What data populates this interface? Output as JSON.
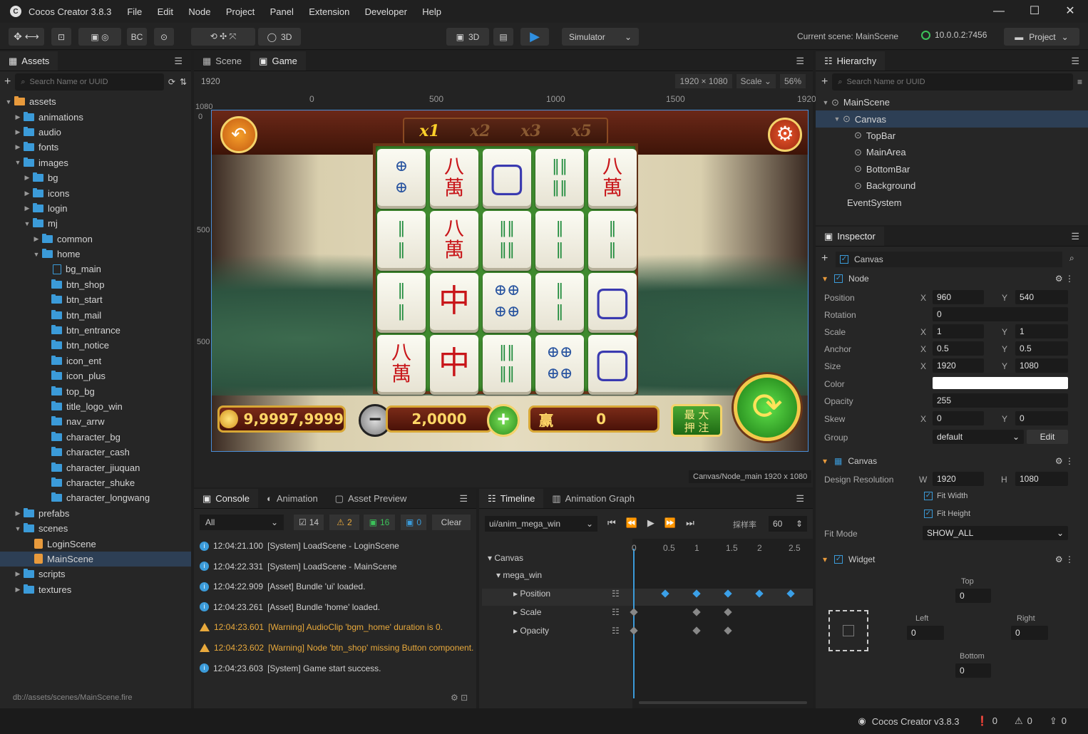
{
  "app": {
    "title": "Cocos Creator 3.8.3",
    "logo": "C"
  },
  "menu": [
    "File",
    "Edit",
    "Node",
    "Project",
    "Panel",
    "Extension",
    "Developer",
    "Help"
  ],
  "window_controls": [
    "—",
    "☐",
    "✕"
  ],
  "toolbar": {
    "scene3d_left": "3D",
    "scene3d_right": "3D",
    "play_label": "▶",
    "simulator": "Simulator",
    "current_scene": "Current scene: MainScene",
    "ip": "10.0.0.2:7456",
    "project": "Project"
  },
  "assets": {
    "tab": "Assets",
    "search_placeholder": "Search Name or UUID",
    "footer_path": "db://assets/scenes/MainScene.fire",
    "tree": [
      {
        "label": "assets",
        "depth": 0,
        "type": "root",
        "arrow": "▼"
      },
      {
        "label": "animations",
        "depth": 1,
        "type": "folder",
        "arrow": "▶"
      },
      {
        "label": "audio",
        "depth": 1,
        "type": "folder",
        "arrow": "▶"
      },
      {
        "label": "fonts",
        "depth": 1,
        "type": "folder",
        "arrow": "▶"
      },
      {
        "label": "images",
        "depth": 1,
        "type": "folder",
        "arrow": "▼"
      },
      {
        "label": "bg",
        "depth": 2,
        "type": "folder",
        "arrow": "▶"
      },
      {
        "label": "icons",
        "depth": 2,
        "type": "folder",
        "arrow": "▶"
      },
      {
        "label": "login",
        "depth": 2,
        "type": "folder",
        "arrow": "▶"
      },
      {
        "label": "mj",
        "depth": 2,
        "type": "folder",
        "arrow": "▼"
      },
      {
        "label": "common",
        "depth": 3,
        "type": "folder",
        "arrow": "▶"
      },
      {
        "label": "home",
        "depth": 3,
        "type": "folder",
        "arrow": "▼"
      },
      {
        "label": "bg_main",
        "depth": 4,
        "type": "file",
        "arrow": ""
      },
      {
        "label": "btn_shop",
        "depth": 4,
        "type": "folder",
        "arrow": ""
      },
      {
        "label": "btn_start",
        "depth": 4,
        "type": "folder",
        "arrow": ""
      },
      {
        "label": "btn_mail",
        "depth": 4,
        "type": "folder",
        "arrow": ""
      },
      {
        "label": "btn_entrance",
        "depth": 4,
        "type": "folder",
        "arrow": ""
      },
      {
        "label": "btn_notice",
        "depth": 4,
        "type": "folder",
        "arrow": ""
      },
      {
        "label": "icon_ent",
        "depth": 4,
        "type": "folder",
        "arrow": ""
      },
      {
        "label": "icon_plus",
        "depth": 4,
        "type": "folder",
        "arrow": ""
      },
      {
        "label": "top_bg",
        "depth": 4,
        "type": "folder",
        "arrow": ""
      },
      {
        "label": "title_logo_win",
        "depth": 4,
        "type": "folder",
        "arrow": ""
      },
      {
        "label": "nav_arrw",
        "depth": 4,
        "type": "folder",
        "arrow": ""
      },
      {
        "label": "character_bg",
        "depth": 4,
        "type": "folder",
        "arrow": ""
      },
      {
        "label": "character_cash",
        "depth": 4,
        "type": "folder",
        "arrow": ""
      },
      {
        "label": "character_jiuquan",
        "depth": 4,
        "type": "folder",
        "arrow": ""
      },
      {
        "label": "character_shuke",
        "depth": 4,
        "type": "folder",
        "arrow": ""
      },
      {
        "label": "character_longwang",
        "depth": 4,
        "type": "folder",
        "arrow": ""
      },
      {
        "label": "prefabs",
        "depth": 1,
        "type": "folder",
        "arrow": "▶"
      },
      {
        "label": "scenes",
        "depth": 1,
        "type": "folder",
        "arrow": "▼"
      },
      {
        "label": "LoginScene",
        "depth": 2,
        "type": "scene",
        "arrow": ""
      },
      {
        "label": "MainScene",
        "depth": 2,
        "type": "scene",
        "arrow": "",
        "selected": true
      },
      {
        "label": "scripts",
        "depth": 1,
        "type": "folder",
        "arrow": "▶"
      },
      {
        "label": "textures",
        "depth": 1,
        "type": "folder",
        "arrow": "▶"
      }
    ]
  },
  "viewport": {
    "tabs": [
      "Scene",
      "Game"
    ],
    "width_label": "1920",
    "resolution": "1920 × 1080",
    "scale_label": "Scale",
    "zoom": "56%",
    "ruler_x": [
      "0",
      "500",
      "1000",
      "1500",
      "1920"
    ],
    "ruler_y": [
      "1080",
      "0",
      "500",
      "500"
    ],
    "status": "Canvas/Node_main 1920 x 1080"
  },
  "game": {
    "multipliers": [
      "x1",
      "x2",
      "x3",
      "x5"
    ],
    "tiles": [
      [
        "⊕\n⊕",
        "八\n萬",
        "▢",
        "‖‖\n‖‖",
        "八\n萬"
      ],
      [
        "‖\n‖",
        "八\n萬",
        "‖‖\n‖‖",
        "‖\n‖",
        "‖\n‖"
      ],
      [
        "‖\n‖",
        "中",
        "⊕⊕\n⊕⊕",
        "‖\n‖",
        "▢"
      ],
      [
        "八\n萬",
        "中",
        "‖‖\n‖‖",
        "⊕⊕\n⊕⊕",
        "▢"
      ]
    ],
    "coins": "9,9997,9999",
    "bet": "2,0000",
    "win_label": "赢",
    "win_value": "0",
    "max_bet": "最 大\n押 注"
  },
  "console": {
    "tabs": [
      "Console",
      "Animation",
      "Asset Preview"
    ],
    "filter": "All",
    "counts": {
      "log": "14",
      "warn": "2",
      "info": "16",
      "error": "0"
    },
    "clear": "Clear",
    "lines": [
      {
        "time": "12:04:21.100",
        "text": "[System] LoadScene - LoginScene",
        "level": "info"
      },
      {
        "time": "12:04:22.331",
        "text": "[System] LoadScene - MainScene",
        "level": "info"
      },
      {
        "time": "12:04:22.909",
        "text": "[Asset] Bundle 'ui' loaded.",
        "level": "info"
      },
      {
        "time": "12:04:23.261",
        "text": "[Asset] Bundle 'home' loaded.",
        "level": "info"
      },
      {
        "time": "12:04:23.601",
        "text": "[Warning] AudioClip 'bgm_home' duration is 0.",
        "level": "warn"
      },
      {
        "time": "12:04:23.602",
        "text": "[Warning] Node 'btn_shop' missing Button component.",
        "level": "warn"
      },
      {
        "time": "12:04:23.603",
        "text": "[System] Game start success.",
        "level": "info"
      }
    ]
  },
  "timeline": {
    "tabs": [
      "Timeline",
      "Animation Graph"
    ],
    "clip": "ui/anim_mega_win",
    "sample_label": "採样率",
    "sample_value": "60",
    "ruler": [
      "0",
      "0.5",
      "1",
      "1.5",
      "2",
      "2.5"
    ],
    "tracks": [
      "Canvas",
      "mega_win",
      "Position",
      "Scale",
      "Opacity"
    ]
  },
  "hierarchy": {
    "tab": "Hierarchy",
    "search_placeholder": "Search Name or UUID",
    "nodes": [
      {
        "label": "MainScene",
        "depth": 0,
        "arrow": "▼"
      },
      {
        "label": "Canvas",
        "depth": 1,
        "arrow": "▼",
        "selected": true
      },
      {
        "label": "TopBar",
        "depth": 2,
        "arrow": ""
      },
      {
        "label": "MainArea",
        "depth": 2,
        "arrow": ""
      },
      {
        "label": "BottomBar",
        "depth": 2,
        "arrow": ""
      },
      {
        "label": "Background",
        "depth": 2,
        "arrow": ""
      },
      {
        "label": "EventSystem",
        "depth": 1,
        "arrow": "",
        "noicon": true
      }
    ]
  },
  "inspector": {
    "tab": "Inspector",
    "node_name": "Canvas",
    "node_section": "Node",
    "props": {
      "position": {
        "label": "Position",
        "x": "960",
        "y": "540"
      },
      "rotation": {
        "label": "Rotation",
        "v": "0"
      },
      "scale": {
        "label": "Scale",
        "x": "1",
        "y": "1"
      },
      "anchor": {
        "label": "Anchor",
        "x": "0.5",
        "y": "0.5"
      },
      "size": {
        "label": "Size",
        "x": "1920",
        "y": "1080"
      },
      "color": {
        "label": "Color",
        "value": "#ffffff"
      },
      "opacity": {
        "label": "Opacity",
        "v": "255"
      },
      "skew": {
        "label": "Skew",
        "x": "0",
        "y": "0"
      },
      "group": {
        "label": "Group",
        "v": "default",
        "edit": "Edit"
      }
    },
    "canvas_section": "Canvas",
    "design_resolution": {
      "label": "Design Resolution",
      "w": "1920",
      "h": "1080"
    },
    "fit_width": "Fit Width",
    "fit_height": "Fit Height",
    "fit_mode": {
      "label": "Fit Mode",
      "v": "SHOW_ALL"
    },
    "widget_section": "Widget",
    "widget": {
      "top": "0",
      "left": "0",
      "right": "0",
      "bottom": "0",
      "top_label": "Top",
      "left_label": "Left",
      "right_label": "Right",
      "bottom_label": "Bottom"
    }
  },
  "statusbar": {
    "version": "Cocos Creator v3.8.3",
    "errors": "0",
    "warnings": "0",
    "updates": "0"
  },
  "colors": {
    "accent": "#3b9bd9",
    "folder": "#3b9bd9",
    "play": "#2f8fe0",
    "warning": "#e8a93c",
    "online": "#3cc25a"
  }
}
